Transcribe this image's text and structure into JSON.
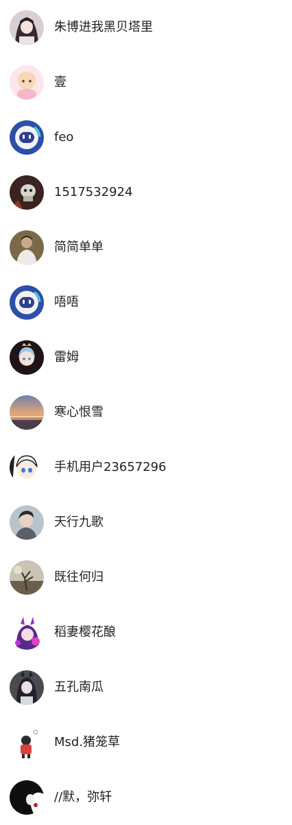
{
  "users": [
    {
      "name": "朱博进我黑贝塔里",
      "avatar": "anime-girl-dark-hair-avatar"
    },
    {
      "name": "壹",
      "avatar": "pink-anime-chibi-avatar"
    },
    {
      "name": "feo",
      "avatar": "blue-robot-avatar"
    },
    {
      "name": "1517532924",
      "avatar": "dark-mask-avatar"
    },
    {
      "name": "简简单单",
      "avatar": "person-photo-avatar"
    },
    {
      "name": "唔唔",
      "avatar": "blue-robot-avatar"
    },
    {
      "name": "雷姆",
      "avatar": "rem-anime-avatar"
    },
    {
      "name": "寒心恨雪",
      "avatar": "sunset-scenery-avatar"
    },
    {
      "name": "手机用户23657296",
      "avatar": "white-hair-chibi-avatar"
    },
    {
      "name": "天行九歌",
      "avatar": "portrait-photo-avatar"
    },
    {
      "name": "既往何归",
      "avatar": "misty-scene-avatar"
    },
    {
      "name": "稻妻樱花酿",
      "avatar": "purple-anime-avatar"
    },
    {
      "name": "五孔南瓜",
      "avatar": "dark-anime-character-avatar"
    },
    {
      "name": "Msd.猪笼草",
      "avatar": "red-figure-avatar"
    },
    {
      "name": "//默，弥轩",
      "avatar": "black-white-silhouette-avatar"
    }
  ]
}
